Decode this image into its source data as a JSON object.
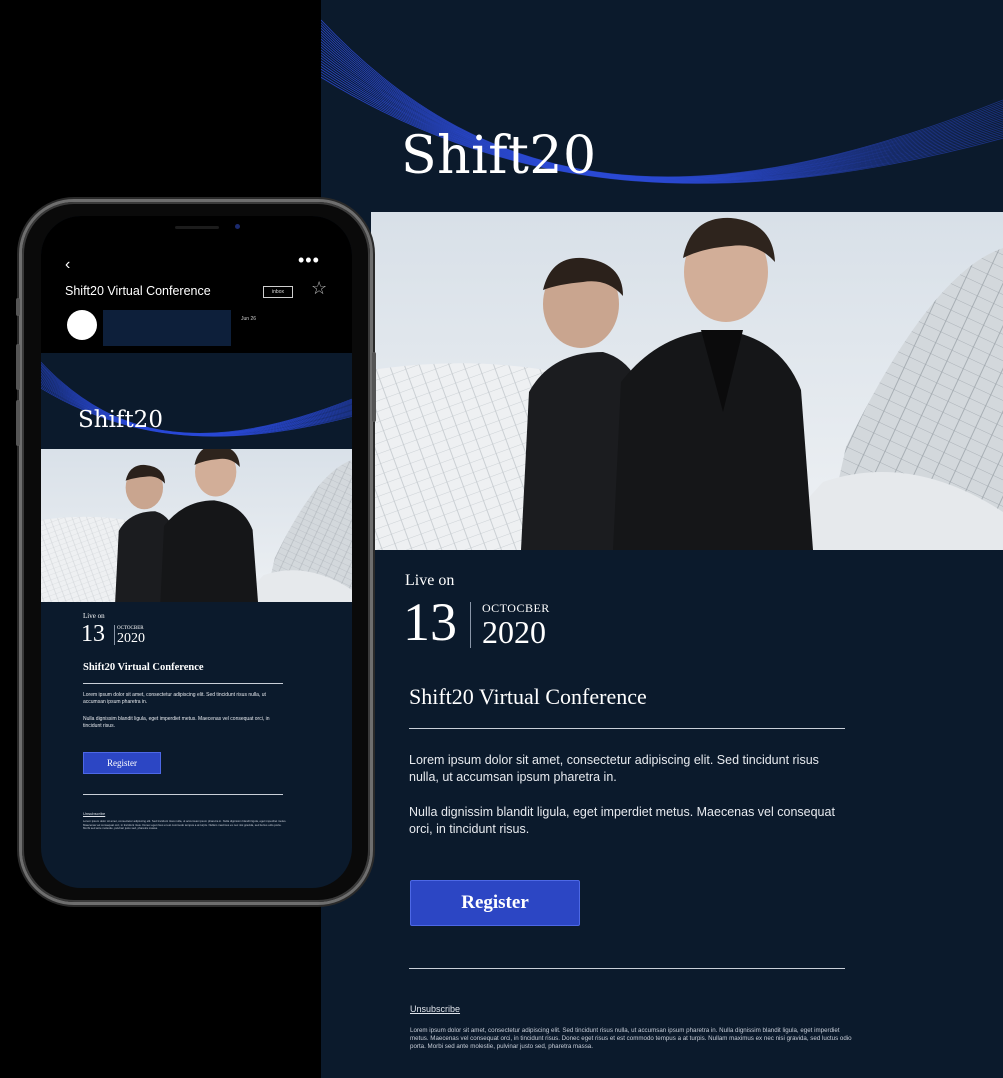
{
  "email": {
    "brand": "Shift20",
    "live_label": "Live on",
    "day": "13",
    "month": "OCTOCBER",
    "year": "2020",
    "title": "Shift20 Virtual Conference",
    "paragraph_1": "Lorem ipsum dolor sit amet, consectetur adipiscing elit. Sed tincidunt risus nulla, ut accumsan ipsum pharetra in.",
    "paragraph_2": "Nulla dignissim blandit ligula, eget imperdiet metus. Maecenas vel consequat orci, in tincidunt risus.",
    "register_label": "Register",
    "unsubscribe_label": "Unsubscribe",
    "fine_print": "Lorem ipsum dolor sit amet, consectetur adipiscing elit. Sed tincidunt risus nulla, ut accumsan ipsum pharetra in. Nulla dignissim blandit ligula, eget imperdiet metus. Maecenas vel consequat orci, in tincidunt risus. Donec eget risus et est commodo tempus a at turpis. Nullam maximus ex nec nisi gravida, sed luctus odio porta. Morbi sed ante molestie, pulvinar justo sed, pharetra massa."
  },
  "phone": {
    "back_icon": "chevron-left-icon",
    "back_glyph": "‹",
    "more_glyph": "•••",
    "subject": "Shift20 Virtual Conference",
    "label_badge": "inbox",
    "star_glyph": "☆",
    "date": "Jun 26"
  },
  "colors": {
    "background": "#0b1a2c",
    "button": "#2c46c4",
    "wave": "#2a46c8"
  }
}
